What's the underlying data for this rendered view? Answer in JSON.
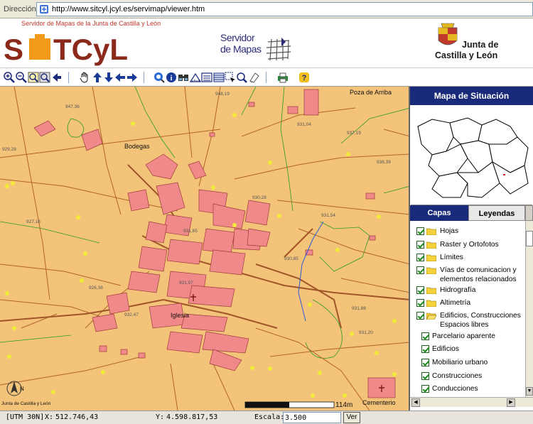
{
  "browser": {
    "address_label": "Dirección",
    "url": "http://www.sitcyl.jcyl.es/servimap/viewer.htm"
  },
  "header": {
    "subtitle": "Servidor de Mapas de la Junta de Castilla y León",
    "brand": "SITCyL",
    "servidor_line1": "Servidor",
    "servidor_line2": "de Mapas",
    "jcyl_line1": "Junta de",
    "jcyl_line2": "Castilla y León"
  },
  "toolbar": {
    "icons": [
      "zoom-in-icon",
      "zoom-out-icon",
      "zoom-extent-icon",
      "zoom-previous-icon",
      "back-icon",
      "pan-icon",
      "pan-up-icon",
      "pan-down-icon",
      "pan-left-icon",
      "pan-right-icon",
      "identify-icon",
      "info-icon",
      "find-icon",
      "measure-icon",
      "select-icon",
      "query-icon",
      "clear-icon",
      "print-icon",
      "help-icon"
    ]
  },
  "map": {
    "place_labels": [
      "Poza de Arriba",
      "Bodegas",
      "Iglesia",
      "Cementerio"
    ],
    "elevation_labels": [
      "948,19",
      "947,36",
      "929,28",
      "937,19",
      "936,39",
      "927,16",
      "926,38",
      "932,47",
      "931,97",
      "931,04",
      "931,54",
      "930,85",
      "931,65",
      "930,28",
      "931,88",
      "931,20"
    ],
    "scale_bar": {
      "start": "0",
      "end": "114m"
    },
    "copyright": "Junta de Castilla y León",
    "colors": {
      "background": "#f3c37a",
      "buildings": "#f08a8a",
      "roads": "#b4642a",
      "boundaries": "#2a8a2a"
    }
  },
  "panel": {
    "title": "Mapa de Situación",
    "tab_capas": "Capas",
    "tab_leyendas": "Leyendas",
    "layers": [
      {
        "label": "Hojas",
        "folder": true,
        "indent": 0
      },
      {
        "label": "Raster y Ortofotos",
        "folder": true,
        "indent": 0
      },
      {
        "label": "Límites",
        "folder": true,
        "indent": 0
      },
      {
        "label": "Vías de comunicacion y elementos relacionados",
        "folder": true,
        "indent": 0
      },
      {
        "label": "Hidrografía",
        "folder": true,
        "indent": 0
      },
      {
        "label": "Altimetría",
        "folder": true,
        "indent": 0
      },
      {
        "label": "Edificios, Construcciones Espacios libres",
        "folder": true,
        "indent": 0
      },
      {
        "label": "Parcelario aparente",
        "folder": false,
        "indent": 1
      },
      {
        "label": "Edificios",
        "folder": false,
        "indent": 1
      },
      {
        "label": "Mobiliario urbano",
        "folder": false,
        "indent": 1
      },
      {
        "label": "Construcciones",
        "folder": false,
        "indent": 1
      },
      {
        "label": "Conducciones",
        "folder": false,
        "indent": 1
      }
    ]
  },
  "status": {
    "utm": "[UTM 30N]",
    "x_label": "X:",
    "x_value": "512.746,43",
    "y_label": "Y:",
    "y_value": "4.598.817,53",
    "escala_label": "Escala:",
    "escala_value": "3.500",
    "ver_label": "Ver"
  }
}
